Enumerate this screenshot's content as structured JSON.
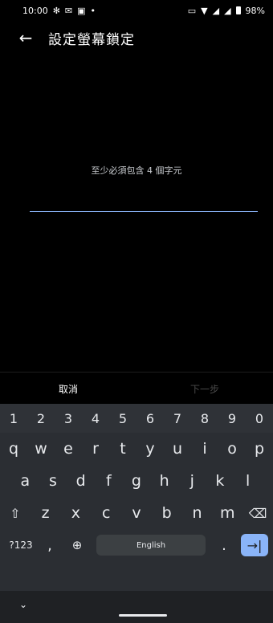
{
  "status_bar": {
    "time": "10:00",
    "battery_percent_label": "98%",
    "battery_level": 0.98,
    "icons": [
      "gear-icon",
      "gmail-icon",
      "screenshot-icon",
      "dot-icon",
      "vibrate-icon",
      "wifi-icon",
      "signal-4g-icon",
      "signal-icon",
      "battery-icon"
    ]
  },
  "app_bar": {
    "back_icon": "back-arrow-icon",
    "title": "設定螢幕鎖定"
  },
  "form": {
    "hint": "至少必須包含 4 個字元",
    "pin_value": ""
  },
  "actions": {
    "cancel_label": "取消",
    "next_label": "下一步"
  },
  "keyboard": {
    "numbers": [
      "1",
      "2",
      "3",
      "4",
      "5",
      "6",
      "7",
      "8",
      "9",
      "0"
    ],
    "row1": [
      "q",
      "w",
      "e",
      "r",
      "t",
      "y",
      "u",
      "i",
      "o",
      "p"
    ],
    "row2": [
      "a",
      "s",
      "d",
      "f",
      "g",
      "h",
      "j",
      "k",
      "l"
    ],
    "row3": [
      "z",
      "x",
      "c",
      "v",
      "b",
      "n",
      "m"
    ],
    "symbols_label": "?123",
    "comma": ",",
    "space_label": "English",
    "period": ".",
    "shift_icon": "shift-icon",
    "backspace_icon": "backspace-icon",
    "globe_icon": "globe-icon",
    "enter_icon": "tab-next-icon"
  },
  "nav": {
    "collapse_icon": "chevron-down-icon"
  },
  "colors": {
    "accent": "#8ab4f8",
    "background": "#000000",
    "keyboard_bg": "#2b2e33"
  }
}
